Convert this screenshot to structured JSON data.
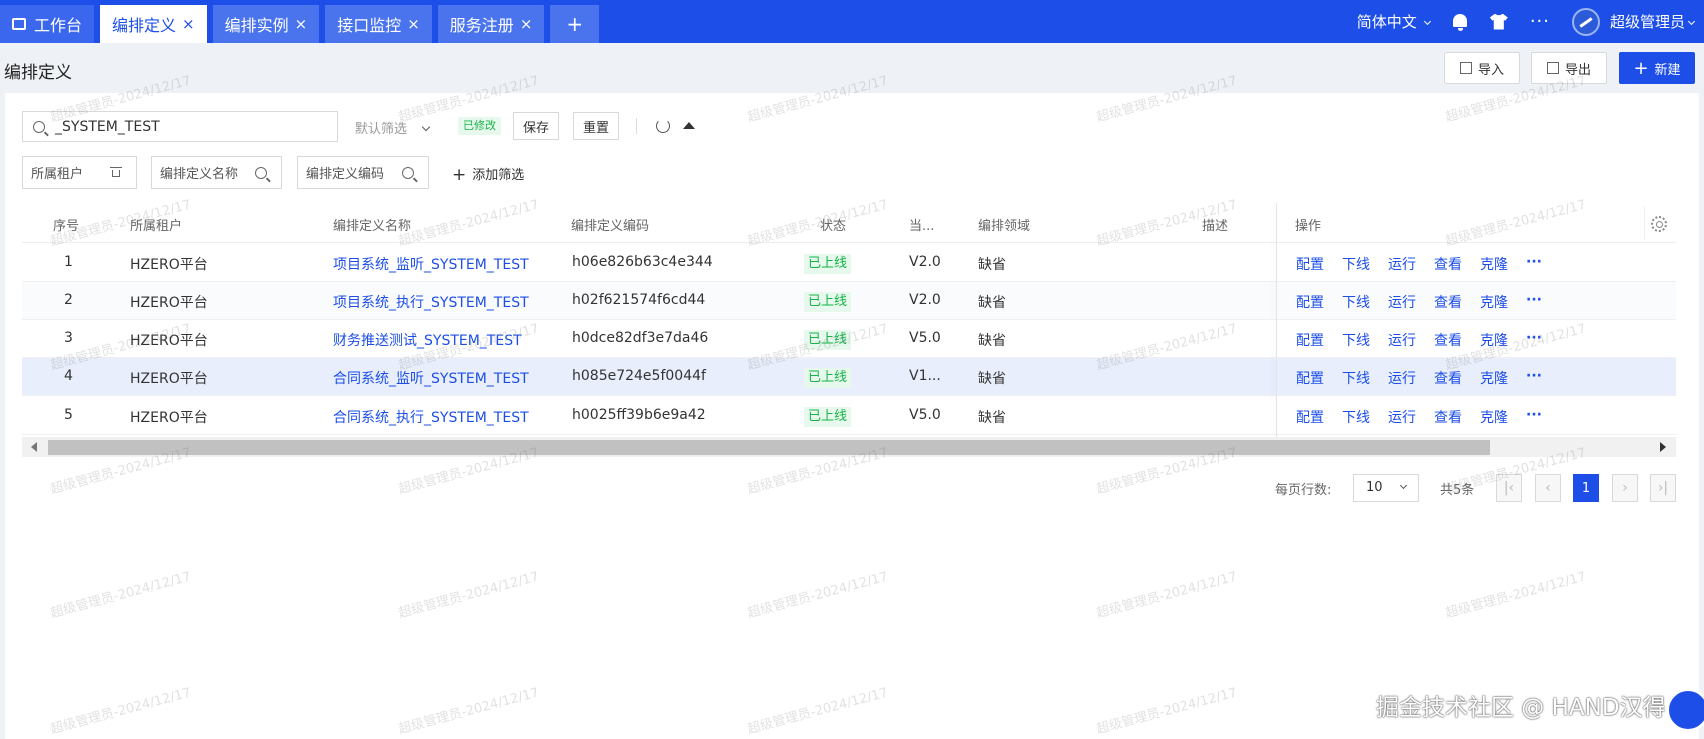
{
  "tabs": [
    {
      "label": "工作台",
      "closable": false,
      "active": false
    },
    {
      "label": "编排定义",
      "closable": true,
      "active": true
    },
    {
      "label": "编排实例",
      "closable": true,
      "active": false
    },
    {
      "label": "接口监控",
      "closable": true,
      "active": false
    },
    {
      "label": "服务注册",
      "closable": true,
      "active": false
    }
  ],
  "tab_close": "×",
  "add_tab": "+",
  "header": {
    "language": "简体中文",
    "more": "···",
    "user_name": "超级管理员"
  },
  "page": {
    "title": "编排定义",
    "import_label": "导入",
    "export_label": "导出",
    "new_label": "新建",
    "new_plus": "+"
  },
  "search": {
    "value": "_SYSTEM_TEST",
    "filter_select": "默认筛选",
    "modified_badge": "已修改",
    "save_label": "保存",
    "reset_label": "重置"
  },
  "filters": {
    "tenant": "所属租户",
    "name": "编排定义名称",
    "code": "编排定义编码",
    "add_filter": "添加筛选",
    "add_plus": "+"
  },
  "table": {
    "columns": {
      "index": "序号",
      "tenant": "所属租户",
      "name": "编排定义名称",
      "code": "编排定义编码",
      "status": "状态",
      "version": "当...",
      "domain": "编排领域",
      "desc": "描述",
      "actions": "操作"
    },
    "rows": [
      {
        "index": "1",
        "tenant": "HZERO平台",
        "name": "项目系统_监听_SYSTEM_TEST",
        "code": "h06e826b63c4e344",
        "status": "已上线",
        "version": "V2.0",
        "domain": "缺省",
        "desc": ""
      },
      {
        "index": "2",
        "tenant": "HZERO平台",
        "name": "项目系统_执行_SYSTEM_TEST",
        "code": "h02f621574f6cd44",
        "status": "已上线",
        "version": "V2.0",
        "domain": "缺省",
        "desc": ""
      },
      {
        "index": "3",
        "tenant": "HZERO平台",
        "name": "财务推送测试_SYSTEM_TEST",
        "code": "h0dce82df3e7da46",
        "status": "已上线",
        "version": "V5.0",
        "domain": "缺省",
        "desc": ""
      },
      {
        "index": "4",
        "tenant": "HZERO平台",
        "name": "合同系统_监听_SYSTEM_TEST",
        "code": "h085e724e5f0044f",
        "status": "已上线",
        "version": "V1...",
        "domain": "缺省",
        "desc": ""
      },
      {
        "index": "5",
        "tenant": "HZERO平台",
        "name": "合同系统_执行_SYSTEM_TEST",
        "code": "h0025ff39b6e9a42",
        "status": "已上线",
        "version": "V5.0",
        "domain": "缺省",
        "desc": ""
      }
    ],
    "row_actions": [
      "配置",
      "下线",
      "运行",
      "查看",
      "克隆",
      "···"
    ]
  },
  "pagination": {
    "page_size_label": "每页行数:",
    "page_size": "10",
    "total": "共5条",
    "current_page": "1",
    "first": "|‹",
    "prev": "‹",
    "next": "›",
    "last": "›|"
  },
  "watermark": "超级管理员-2024/12/17",
  "footer_watermark": "掘金技术社区 @ HAND汉得",
  "colors": {
    "primary": "#1d4fe8",
    "status_green": "#17b34a",
    "status_bg": "#e6f9ec",
    "highlight_row": "#e8eefb"
  }
}
